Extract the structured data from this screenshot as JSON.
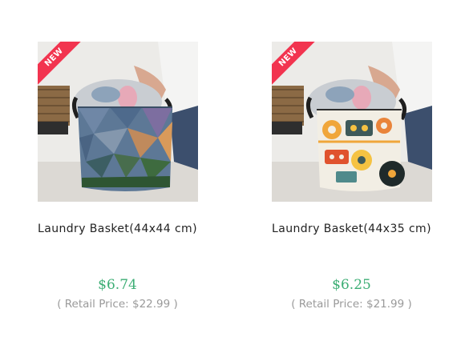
{
  "products": [
    {
      "badge": "NEW",
      "title": "Laundry Basket(44x44 cm)",
      "price": "$6.74",
      "retail_open": "( ",
      "retail_label": "Retail Price: ",
      "retail_value": "$22.99",
      "retail_close": " )",
      "image_icon": "laundry-basket-lowpoly-image"
    },
    {
      "badge": "NEW",
      "title": "Laundry Basket(44x35 cm)",
      "price": "$6.25",
      "retail_open": "( ",
      "retail_label": "Retail Price: ",
      "retail_value": "$21.99",
      "retail_close": " )",
      "image_icon": "laundry-basket-retro-image"
    }
  ],
  "colors": {
    "price": "#3dae75",
    "retail": "#9a9a9a",
    "badge": "#f2344f",
    "title": "#222222"
  }
}
